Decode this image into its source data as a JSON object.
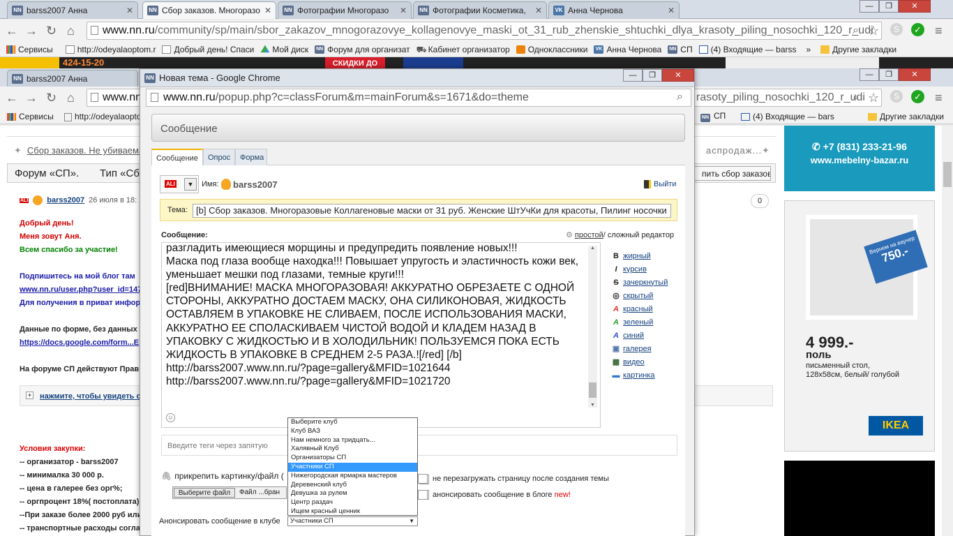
{
  "tabs": [
    {
      "label": "barss2007 Анна",
      "icon": "nn-favicon",
      "active": false
    },
    {
      "label": "Сбор заказов. Многоразо",
      "icon": "nn-favicon",
      "active": true
    },
    {
      "label": "Фотографии Многоразо",
      "icon": "nn-favicon",
      "active": false
    },
    {
      "label": "Фотографии Косметика,",
      "icon": "nn-favicon",
      "active": false
    },
    {
      "label": "Анна Чернова",
      "icon": "vk-favicon",
      "active": false
    }
  ],
  "address": {
    "host": "www.nn.ru",
    "path": "/community/sp/main/sbor_zakazov_mnogorazovye_kollagenovye_maski_ot_31_rub_zhenskie_shtuchki_dlya_krasoty_piling_nosochki_120_r_udi"
  },
  "bookmarks": [
    {
      "label": "Сервисы"
    },
    {
      "label": "http://odeyalaoptom.r"
    },
    {
      "label": "Добрый день! Спаси"
    },
    {
      "label": "Мой диск"
    },
    {
      "label": "Форум для организат"
    },
    {
      "label": "Кабинет организатор"
    },
    {
      "label": "Одноклассники"
    },
    {
      "label": "Анна Чернова"
    },
    {
      "label": "СП"
    },
    {
      "label": "(4) Входящие — barss"
    }
  ],
  "bookmarks_more": "»",
  "bookmarks_other": "Другие закладки",
  "bg_tab": {
    "label": "barss2007 Анна"
  },
  "bg_address_host": "www.nn",
  "bg_address_tail": "rasoty_piling_nosochki_120_r_udi",
  "bg_bookmarks": {
    "services": "Сервисы",
    "link": "http://odeyalaopto",
    "sp": "СП",
    "inbox": "(4) Входящие — bars",
    "other": "Другие закладки"
  },
  "bg_page": {
    "breadcrumb": "Сбор заказов. Не убиваема",
    "breadcrumb_right": "аспродаж...",
    "forum_title": "Форум «СП».",
    "forum_type": "Тип «Сб",
    "collect_button": "пить сбор заказов",
    "author": "barss2007",
    "date": "26 июля в 18:",
    "count": "0",
    "lines": [
      {
        "text": "Добрый день!",
        "color": "#d00000"
      },
      {
        "text": "Меня зовут Аня.",
        "color": "#d00000"
      },
      {
        "text": "Всем спасибо за участие!",
        "color": "#008000"
      },
      {
        "text": "Подпишитесь на мой блог там",
        "color": "#1a1aa8"
      },
      {
        "text": "www.nn.ru/user.php?user_id=147",
        "color": "#1a1aa8"
      },
      {
        "text": "Для получения в приват инфор",
        "color": "#1a1aa8"
      },
      {
        "text": "Данные по форме, без данных",
        "color": "#222222"
      },
      {
        "text": "https://docs.google.com/form...E",
        "color": "#1a1aa8"
      },
      {
        "text": "На форуме СП действуют Прав",
        "color": "#222222"
      }
    ],
    "spoiler": "нажмите, чтобы увидеть с",
    "conditions_title": "Условия закупки:",
    "conditions": [
      "-- организатор - barss2007",
      "-- минималка 30 000 р.",
      "-- цена в галерее без орг%;",
      "-- оргпроцент 18%( постоплата)",
      "--При заказе более 2000 руб или",
      "-- транспортные расходы согла"
    ],
    "ad_phone": "+7 (831) 233-21-96",
    "ad_site": "www.mebelny-bazar.ru",
    "ad_ikea_badge_1": "Вернем на ваучер",
    "ad_ikea_badge_2": "750.-",
    "ad_ikea_price": "4 999.-",
    "ad_ikea_item": "поль",
    "ad_ikea_desc": "письменный стол, 128x58см, белый/ голубой",
    "ad_ikea_logo": "IKEA",
    "top_banner_1": "424-15-20",
    "top_banner_2": "СКИДКИ ДО"
  },
  "popup": {
    "title": "Новая тема - Google Chrome",
    "url_host": "www.nn.ru",
    "url_path": "/popup.php?c=classForum&m=mainForum&s=1671&do=theme",
    "header": "Сообщение",
    "form_tabs": [
      "Сообщение",
      "Опрос",
      "Форма"
    ],
    "name_label": "Имя:",
    "username": "barss2007",
    "logout": "Выйти",
    "topic_label": "Тема:",
    "topic_value": "[b] Сбор заказов. Многоразовые Коллагеновые маски от 31 руб. Женские ШтУчКи для красоты, Пилинг носочки",
    "message_label": "Сообщение:",
    "editor_mode_simple": "простой",
    "editor_mode_sep": " / сложный редактор",
    "message_text": "разгладить имеющиеся морщины и предупредить появление новых!!!\nМаска под глаза вообще находка!!! Повышает упругость и эластичность кожи век, уменьшает мешки под глазами, темные круги!!!\n[red]ВНИМАНИЕ! МАСКА МНОГОРАЗОВАЯ! АККУРАТНО ОБРЕЗАЕТЕ С ОДНОЙ СТОРОНЫ, АККУРАТНО ДОСТАЕМ МАСКУ, ОНА СИЛИКОНОВАЯ, ЖИДКОСТЬ ОСТАВЛЯЕМ В УПАКОВКЕ НЕ СЛИВАЕМ, ПОСЛЕ ИСПОЛЬЗОВАНИЯ МАСКИ, АККУРАТНО ЕЕ СПОЛАСКИВАЕМ ЧИСТОЙ ВОДОЙ И КЛАДЕМ НАЗАД В УПАКОВКУ С ЖИДКОСТЬЮ И В ХОЛОДИЛЬНИК! ПОЛЬЗУЕМСЯ ПОКА ЕСТЬ ЖИДКОСТЬ В УПАКОВКЕ В СРЕДНЕМ 2-5 РАЗА.![/red] [/b]\nhttp://barss2007.www.nn.ru/?page=gallery&MFID=1021644\nhttp://barss2007.www.nn.ru/?page=gallery&MFID=1021720",
    "format_buttons": [
      {
        "icon": "B",
        "label": "жирный",
        "color": "#333333"
      },
      {
        "icon": "I",
        "label": "курсив",
        "color": "#333333"
      },
      {
        "icon": "S",
        "label": "зачеркнутый",
        "color": "#333333"
      },
      {
        "icon": "◎",
        "label": "скрытый",
        "color": "#333333"
      },
      {
        "icon": "A",
        "label": "красный",
        "color": "#e03030"
      },
      {
        "icon": "A",
        "label": "зеленый",
        "color": "#30a030"
      },
      {
        "icon": "A",
        "label": "синий",
        "color": "#3050d0"
      },
      {
        "icon": "▣",
        "label": "галерея",
        "color": "#5577aa"
      },
      {
        "icon": "▦",
        "label": "видео",
        "color": "#336633"
      },
      {
        "icon": "▬",
        "label": "картинка",
        "color": "#3377cc"
      }
    ],
    "tags_placeholder": "Введите теги через запятую",
    "attach_label": "прикрепить картинку/файл (",
    "choose_file": "Выберите файл",
    "file_status": "Файл ...бран",
    "no_reload": "не перезагружать страницу после создания темы",
    "announce_blog": "анонсировать сообщение в блоге",
    "announce_new": "new!",
    "announce_club_label": "Анонсировать сообщение в клубе",
    "club_selected": "Участники СП",
    "club_options": [
      "Выберите клуб",
      "Клуб ВАЗ",
      "Нам немного за тридцать...",
      "Халявный Клуб",
      "Организаторы СП",
      "Участники СП",
      "Нижегородская ярмарка мастеров",
      "Деревенский клуб",
      "Девушка за рулем",
      "Центр раздач",
      "Ищем красный ценник"
    ],
    "club_highlight_index": 5
  }
}
